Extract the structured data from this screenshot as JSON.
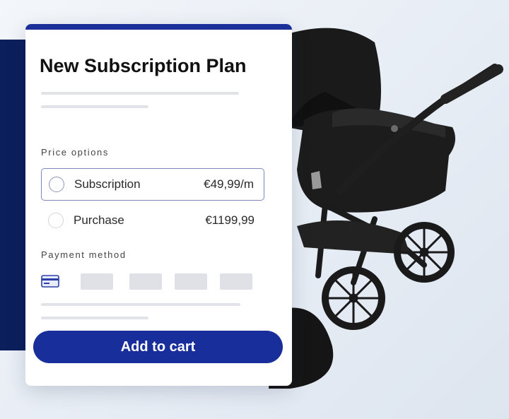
{
  "card": {
    "title": "New Subscription Plan",
    "price_options_label": "Price options",
    "payment_method_label": "Payment method",
    "options": [
      {
        "label": "Subscription",
        "price": "€49,99/m",
        "selected": true
      },
      {
        "label": "Purchase",
        "price": "€1199,99",
        "selected": false
      }
    ],
    "cart_button_label": "Add to cart"
  },
  "colors": {
    "accent": "#1a2f9a",
    "button": "#182e9a",
    "sidebar_strip": "#0b1f5c",
    "selected_border": "#7d88c2"
  },
  "icons": [
    "credit-card-icon",
    "radio-icon"
  ]
}
